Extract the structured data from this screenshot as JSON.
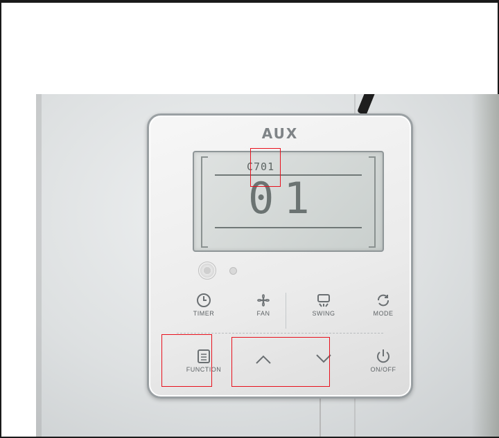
{
  "remote": {
    "brand": "AUX",
    "display": {
      "small_code": "C701",
      "big_code": "01"
    },
    "buttons": [
      {
        "key": "timer",
        "label": "TIMER",
        "icon": "clock-icon"
      },
      {
        "key": "fan",
        "label": "FAN",
        "icon": "fan-icon"
      },
      {
        "key": "swing",
        "label": "SWING",
        "icon": "swing-icon"
      },
      {
        "key": "mode",
        "label": "MODE",
        "icon": "mode-cycle-icon"
      },
      {
        "key": "function",
        "label": "FUNCTION",
        "icon": "menu-icon"
      },
      {
        "key": "up",
        "label": "",
        "icon": "chevron-up-icon"
      },
      {
        "key": "down",
        "label": "",
        "icon": "chevron-down-icon"
      },
      {
        "key": "onoff",
        "label": "ON/OFF",
        "icon": "power-icon"
      }
    ]
  },
  "annotations": {
    "color": "#e8101c",
    "highlighted": [
      "display-small-code-digit",
      "function-button",
      "up-down-buttons"
    ]
  }
}
